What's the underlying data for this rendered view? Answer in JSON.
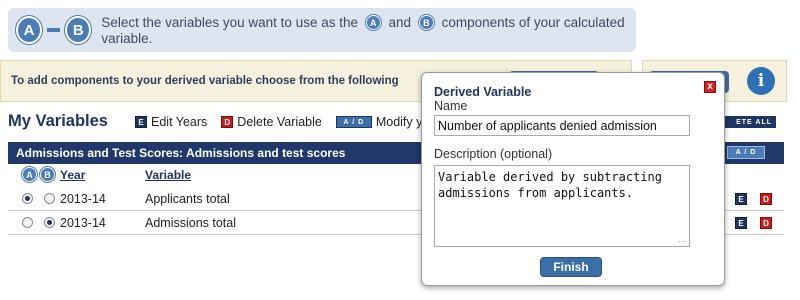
{
  "banner": {
    "badge_a": "A",
    "badge_b": "B",
    "text_1": "Select the variables you want to use as the",
    "text_and": "and",
    "text_2": "components of your calculated variable."
  },
  "components_bar": {
    "text": "To add components to your derived variable choose from the following"
  },
  "info_icon": "i",
  "section": {
    "title": "My Variables",
    "edit_years": "Edit Years",
    "delete_variable": "Delete Variable",
    "ad_badge": "A / D",
    "modify": "Modify y",
    "delete_all": "ETE ALL",
    "icon_e": "E",
    "icon_d": "D"
  },
  "table": {
    "header": "Admissions and Test Scores: Admissions and test scores",
    "ad_badge": "A / D",
    "col_a": "A",
    "col_b": "B",
    "col_year": "Year",
    "col_variable": "Variable",
    "rows": [
      {
        "year": "2013-14",
        "variable": "Applicants total",
        "a_selected": true,
        "b_selected": false
      },
      {
        "year": "2013-14",
        "variable": "Admissions total",
        "a_selected": false,
        "b_selected": true
      }
    ]
  },
  "popup": {
    "title": "Derived Variable",
    "close": "x",
    "name_label": "Name",
    "name_value": "Number of applicants denied admission",
    "description_label": "Description (optional)",
    "description_value": "Variable derived by subtracting admissions from applicants.",
    "finish": "Finish"
  },
  "colors": {
    "navy": "#20386a",
    "accent_blue": "#3c6ea8",
    "banner_bg": "#dde6f0",
    "panel_yellow": "#f5f1dc",
    "delete_red": "#cc1b1b"
  }
}
